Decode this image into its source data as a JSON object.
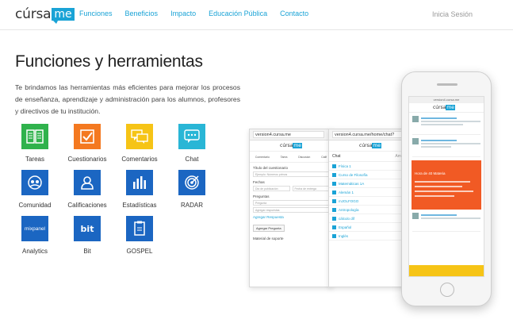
{
  "nav": {
    "logo_text": "cúrsa",
    "logo_badge": "me",
    "links": [
      "Funciones",
      "Beneficios",
      "Impacto",
      "Educación Pública",
      "Contacto"
    ],
    "login": "Inicia Sesión"
  },
  "hero": {
    "title": "Funciones y herramientas",
    "description": "Te brindamos las herramientas más eficientes para mejorar los procesos de enseñanza, aprendizaje y administración para los alumnos, profesores y directivos de tu institución."
  },
  "features": [
    {
      "label": "Tareas",
      "icon": "book-icon",
      "color": "#2fb24c"
    },
    {
      "label": "Cuestionarios",
      "icon": "checkbox-icon",
      "color": "#f47920"
    },
    {
      "label": "Comentarios",
      "icon": "comments-icon",
      "color": "#f6c416"
    },
    {
      "label": "Chat",
      "icon": "chat-bubble-icon",
      "color": "#29b6d6"
    },
    {
      "label": "Comunidad",
      "icon": "community-icon",
      "color": "#1b66c2"
    },
    {
      "label": "Calificaciones",
      "icon": "user-icon",
      "color": "#1b66c2"
    },
    {
      "label": "Estadísticas",
      "icon": "bar-chart-icon",
      "color": "#1b66c2"
    },
    {
      "label": "RADAR",
      "icon": "target-icon",
      "color": "#1b66c2"
    },
    {
      "label": "Analytics",
      "icon": "mixpanel-logo",
      "badge": "mixpanel",
      "color": "#1b66c2"
    },
    {
      "label": "Bit",
      "icon": "bit-logo",
      "badge": "bit",
      "color": "#1b66c2"
    },
    {
      "label": "GOSPEL",
      "icon": "document-icon",
      "color": "#1b66c2"
    }
  ],
  "mockups": {
    "browser1": {
      "url": "version4.cursa.me",
      "tabs": [
        "Comentario",
        "Tarea",
        "Discusion",
        "Calif"
      ],
      "questionnaire_label": "Título del cuestionario",
      "questionnaire_placeholder": "Ejemplo: Números primos",
      "dates_label": "Fechas",
      "date_start": "Dia de publicación",
      "date_end": "Fecha de entrega",
      "questions_label": "Preguntas",
      "question_placeholder": "Pregunta",
      "add_answers": "Agregar respuestas",
      "add_answer_link": "Agregar Respuesta",
      "add_question_btn": "Agregar Pregunta",
      "support_label": "Material de soporte"
    },
    "browser2": {
      "url": "version4.cursa.me/home/chat?",
      "chat_title": "Chat",
      "chat_action": "Amigos",
      "chat_items": [
        "Física 1",
        "Curso de Filosofía",
        "Matemáticas 1A",
        "Alemán 1",
        "mJOLFOGO",
        "Antropología",
        "cálculo dif",
        "Español",
        "Inglés"
      ]
    },
    "phone": {
      "url": "version4.cursa.me",
      "card_title": "Hora de 40 Materia"
    }
  }
}
